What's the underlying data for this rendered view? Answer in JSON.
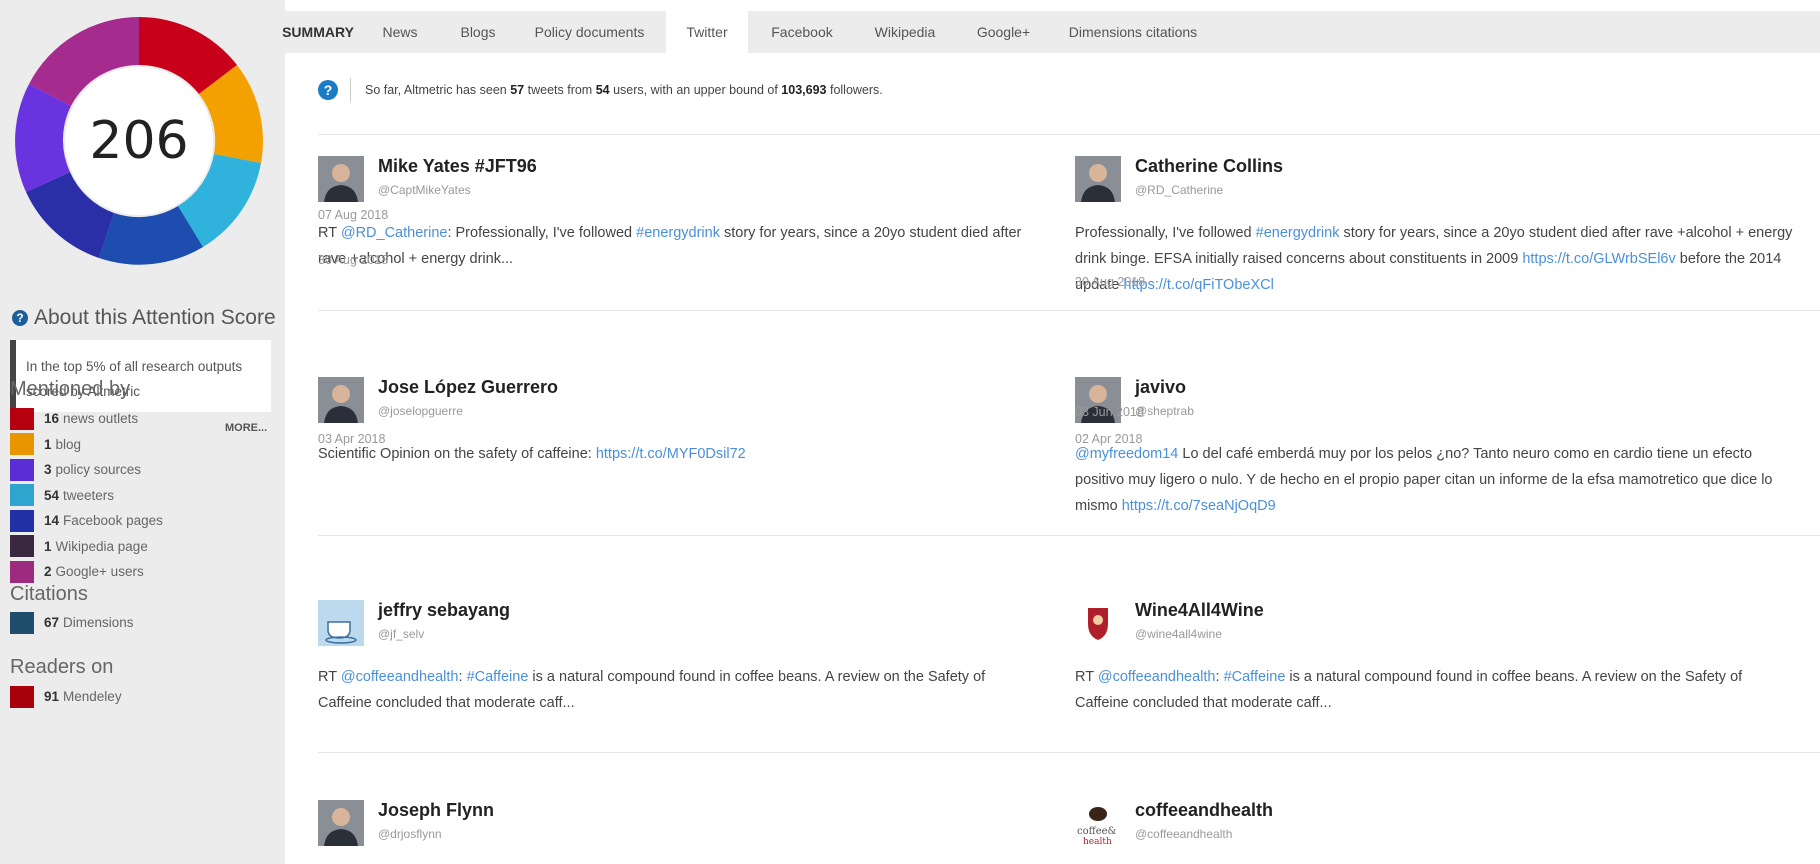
{
  "score": "206",
  "about": {
    "heading": "About this Attention Score",
    "text": "In the top 5% of all research outputs scored by Altmetric",
    "more": "MORE..."
  },
  "mentioned_by": {
    "title": "Mentioned by",
    "items": [
      {
        "count": "16",
        "label": "news outlets",
        "color": "#b5000f"
      },
      {
        "count": "1",
        "label": "blog",
        "color": "#e89500"
      },
      {
        "count": "3",
        "label": "policy sources",
        "color": "#5a2ed6"
      },
      {
        "count": "54",
        "label": "tweeters",
        "color": "#2da5cf"
      },
      {
        "count": "14",
        "label": "Facebook pages",
        "color": "#2130a6"
      },
      {
        "count": "1",
        "label": "Wikipedia page",
        "color": "#3a2840"
      },
      {
        "count": "2",
        "label": "Google+ users",
        "color": "#9c2a7e"
      }
    ]
  },
  "citations": {
    "title": "Citations",
    "items": [
      {
        "count": "67",
        "label": "Dimensions",
        "color": "#1e4e6b"
      }
    ]
  },
  "readers": {
    "title": "Readers on",
    "items": [
      {
        "count": "91",
        "label": "Mendeley",
        "color": "#a8000c"
      }
    ]
  },
  "tabs": [
    "SUMMARY",
    "News",
    "Blogs",
    "Policy documents",
    "Twitter",
    "Facebook",
    "Wikipedia",
    "Google+",
    "Dimensions citations"
  ],
  "active_tab": "Twitter",
  "info": {
    "prefix": "So far, Altmetric has seen",
    "tweets": "57",
    "mid1": "tweets from",
    "users": "54",
    "mid2": "users, with an upper bound of",
    "followers": "103,693",
    "suffix": "followers."
  },
  "tweets": [
    {
      "name": "Mike Yates #JFT96",
      "handle": "@CaptMikeYates",
      "segments": [
        {
          "t": "RT "
        },
        {
          "t": "@RD_Catherine",
          "link": true
        },
        {
          "t": ": Professionally, I've followed "
        },
        {
          "t": "#energydrink",
          "link": true
        },
        {
          "t": " story for years, since a 20yo student died after rave +alcohol + energy drink..."
        }
      ],
      "date": "30 Aug 2018",
      "avatar_icon": "person-photo-icon"
    },
    {
      "name": "Catherine Collins",
      "handle": "@RD_Catherine",
      "segments": [
        {
          "t": "Professionally, I've followed "
        },
        {
          "t": "#energydrink",
          "link": true
        },
        {
          "t": " story for years, since a 20yo student died after rave +alcohol + energy drink binge. EFSA initially raised concerns about constituents in 2009 "
        },
        {
          "t": "https://t.co/GLWrbSEl6v",
          "link": true
        },
        {
          "t": " before the 2014 update "
        },
        {
          "t": "https://t.co/qFiTObeXCl",
          "link": true
        }
      ],
      "date": "30 Aug 2018",
      "avatar_icon": "person-photo-icon"
    },
    {
      "name": "Jose López Guerrero",
      "handle": "@joselopguerre",
      "segments": [
        {
          "t": "Scientific Opinion on the safety of caffeine: "
        },
        {
          "t": "https://t.co/MYF0Dsil72",
          "link": true
        }
      ],
      "date": "07 Aug 2018",
      "avatar_icon": "person-photo-icon"
    },
    {
      "name": "javivo",
      "handle": "@sheptrab",
      "segments": [
        {
          "t": "@myfreedom14",
          "link": true
        },
        {
          "t": " Lo del café emberdá muy por los pelos ¿no? Tanto neuro como en cardio tiene un efecto positivo muy ligero o nulo. Y de hecho en el propio paper citan un informe de la efsa mamotretico que dice lo mismo "
        },
        {
          "t": "https://t.co/7seaNjOqD9",
          "link": true
        }
      ],
      "date": "03 Jun 2018",
      "avatar_icon": "person-photo-icon"
    },
    {
      "name": "jeffry sebayang",
      "handle": "@jf_selv",
      "segments": [
        {
          "t": "RT "
        },
        {
          "t": "@coffeeandhealth",
          "link": true
        },
        {
          "t": ": "
        },
        {
          "t": "#Caffeine",
          "link": true
        },
        {
          "t": " is a natural compound found in coffee beans. A review on the Safety of Caffeine concluded that moderate caff..."
        }
      ],
      "date": "03 Apr 2018",
      "avatar_icon": "coffee-cup-icon"
    },
    {
      "name": "Wine4All4Wine",
      "handle": "@wine4all4wine",
      "segments": [
        {
          "t": "RT "
        },
        {
          "t": "@coffeeandhealth",
          "link": true
        },
        {
          "t": ": "
        },
        {
          "t": "#Caffeine",
          "link": true
        },
        {
          "t": " is a natural compound found in coffee beans. A review on the Safety of Caffeine concluded that moderate caff..."
        }
      ],
      "date": "02 Apr 2018",
      "avatar_icon": "crest-icon"
    },
    {
      "name": "Joseph Flynn",
      "handle": "@drjosflynn",
      "segments": [],
      "date": "",
      "avatar_icon": "person-photo-icon"
    },
    {
      "name": "coffeeandhealth",
      "handle": "@coffeeandhealth",
      "segments": [],
      "date": "",
      "avatar_icon": "coffee-bean-icon",
      "logo_text": [
        "coffee&",
        "health"
      ]
    }
  ]
}
